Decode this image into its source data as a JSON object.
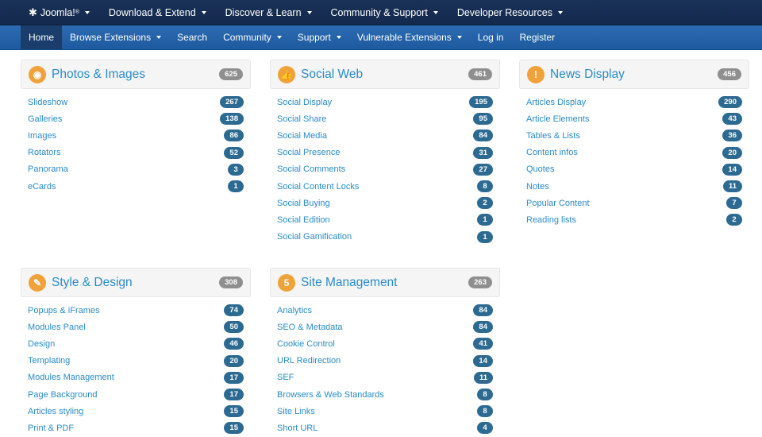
{
  "topbar": {
    "brand": "Joomla!",
    "brand_mark": "®",
    "items": [
      "Download & Extend",
      "Discover & Learn",
      "Community & Support",
      "Developer Resources"
    ]
  },
  "navbar": {
    "items": [
      {
        "label": "Home",
        "active": true,
        "dropdown": false
      },
      {
        "label": "Browse Extensions",
        "active": false,
        "dropdown": true
      },
      {
        "label": "Search",
        "active": false,
        "dropdown": false
      },
      {
        "label": "Community",
        "active": false,
        "dropdown": true
      },
      {
        "label": "Support",
        "active": false,
        "dropdown": true
      },
      {
        "label": "Vulnerable Extensions",
        "active": false,
        "dropdown": true
      },
      {
        "label": "Log in",
        "active": false,
        "dropdown": false
      },
      {
        "label": "Register",
        "active": false,
        "dropdown": false
      }
    ]
  },
  "colors": {
    "accent": "#2a8bc9",
    "icon_bg": "#f0a23a",
    "badge_blue": "#2d6a92",
    "badge_gray": "#8f8f8f",
    "topbar": "#132a4d",
    "navbar": "#2164ad"
  },
  "categories": [
    {
      "title": "Photos & Images",
      "icon": "camera-icon",
      "count": "625",
      "items": [
        [
          "Slideshow",
          "267"
        ],
        [
          "Galleries",
          "138"
        ],
        [
          "Images",
          "86"
        ],
        [
          "Rotators",
          "52"
        ],
        [
          "Panorama",
          "3"
        ],
        [
          "eCards",
          "1"
        ]
      ]
    },
    {
      "title": "Social Web",
      "icon": "thumbs-up-icon",
      "count": "461",
      "items": [
        [
          "Social Display",
          "195"
        ],
        [
          "Social Share",
          "95"
        ],
        [
          "Social Media",
          "84"
        ],
        [
          "Social Presence",
          "31"
        ],
        [
          "Social Comments",
          "27"
        ],
        [
          "Social Content Locks",
          "8"
        ],
        [
          "Social Buying",
          "2"
        ],
        [
          "Social Edition",
          "1"
        ],
        [
          "Social Gamification",
          "1"
        ]
      ]
    },
    {
      "title": "News Display",
      "icon": "exclamation-icon",
      "count": "456",
      "items": [
        [
          "Articles Display",
          "290"
        ],
        [
          "Article Elements",
          "43"
        ],
        [
          "Tables & Lists",
          "36"
        ],
        [
          "Content infos",
          "20"
        ],
        [
          "Quotes",
          "14"
        ],
        [
          "Notes",
          "11"
        ],
        [
          "Popular Content",
          "7"
        ],
        [
          "Reading lists",
          "2"
        ]
      ]
    },
    {
      "title": "Style & Design",
      "icon": "brush-icon",
      "count": "308",
      "items": [
        [
          "Popups & iFrames",
          "74"
        ],
        [
          "Modules Panel",
          "50"
        ],
        [
          "Design",
          "46"
        ],
        [
          "Templating",
          "20"
        ],
        [
          "Modules Management",
          "17"
        ],
        [
          "Page Background",
          "17"
        ],
        [
          "Articles styling",
          "15"
        ],
        [
          "Print & PDF",
          "15"
        ]
      ]
    },
    {
      "title": "Site Management",
      "icon": "html5-icon",
      "count": "263",
      "items": [
        [
          "Analytics",
          "84"
        ],
        [
          "SEO & Metadata",
          "84"
        ],
        [
          "Cookie Control",
          "41"
        ],
        [
          "URL Redirection",
          "14"
        ],
        [
          "SEF",
          "11"
        ],
        [
          "Browsers & Web Standards",
          "8"
        ],
        [
          "Site Links",
          "8"
        ],
        [
          "Short URL",
          "4"
        ]
      ]
    }
  ]
}
